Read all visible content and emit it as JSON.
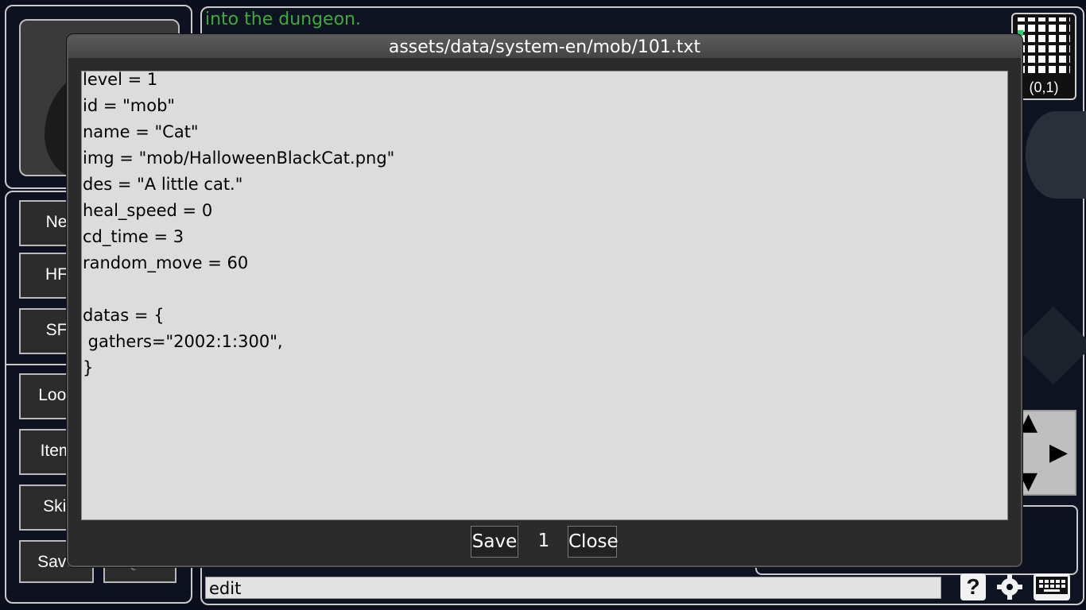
{
  "log": {
    "message": "into the dungeon."
  },
  "minimap": {
    "coords": "(0,1)"
  },
  "menu": {
    "buttons": [
      "Ne",
      "HF",
      "SF",
      "Look",
      "Item",
      "Skil",
      "Save"
    ],
    "quit_label": "Quit"
  },
  "command_bar": {
    "value": "edit"
  },
  "icons": {
    "help": "?",
    "settings": "gear-icon",
    "keyboard": "keyboard-icon"
  },
  "editor": {
    "title": "assets/data/system-en/mob/101.txt",
    "lines": [
      "level = 1",
      "id = \"mob\"",
      "name = \"Cat\"",
      "img = \"mob/HalloweenBlackCat.png\"",
      "des = \"A little cat.\"",
      "heal_speed = 0",
      "cd_time = 3",
      "random_move = 60",
      "",
      "datas = {",
      " gathers=\"2002:1:300\",",
      "}"
    ],
    "save_label": "Save",
    "page": "1",
    "close_label": "Close"
  },
  "colors": {
    "log_text": "#3daa3d",
    "editor_bg": "#dcdcdc",
    "modal_bg": "#2b2b2b"
  }
}
